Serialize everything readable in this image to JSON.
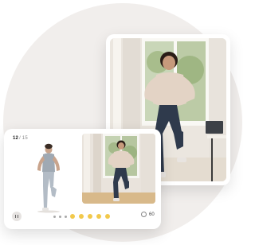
{
  "player": {
    "exercise_current": "12",
    "exercise_total": "/ 15",
    "timer_value": "60"
  },
  "progress": {
    "completed_steps": 3,
    "remaining_steps": 5
  },
  "colors": {
    "accent": "#f2c94c",
    "background_circle": "#f1eeec"
  }
}
